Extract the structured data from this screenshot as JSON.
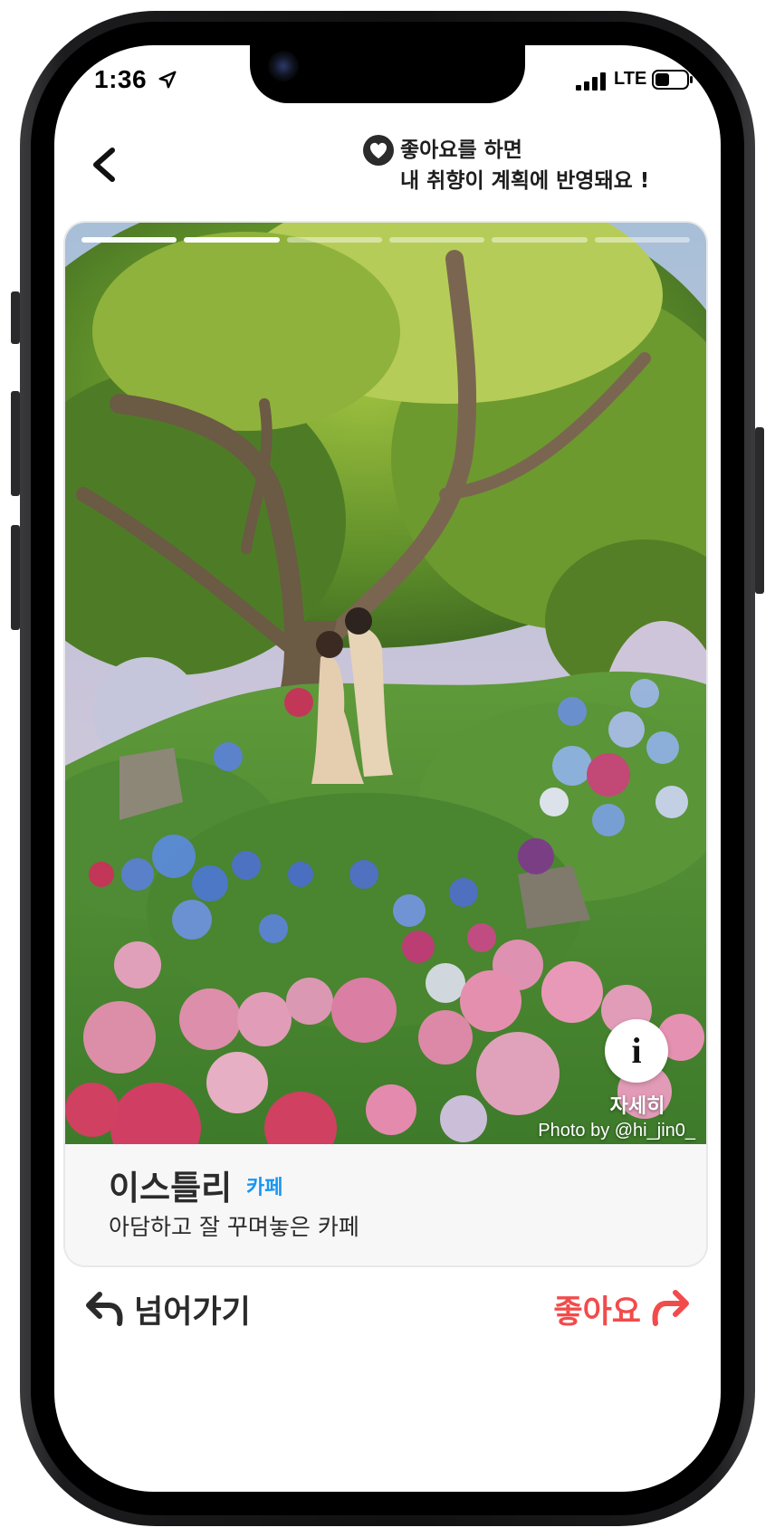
{
  "status_bar": {
    "time": "1:36",
    "network": "LTE"
  },
  "header": {
    "hint_line1": "좋아요를 하면",
    "hint_line2": "내 취향이 계획에 반영돼요 !"
  },
  "card": {
    "progress_total": 6,
    "progress_current": 2,
    "info_label": "자세히",
    "photo_credit": "Photo by @hi_jin0_",
    "place_name": "이스틀리",
    "place_category": "카페",
    "place_description": "아담하고 잘 꾸며놓은 카페"
  },
  "actions": {
    "skip_label": "넘어가기",
    "like_label": "좋아요"
  },
  "colors": {
    "accent_red": "#f24b4b",
    "category_blue": "#1896f2",
    "text_dark": "#2b2b2b"
  }
}
